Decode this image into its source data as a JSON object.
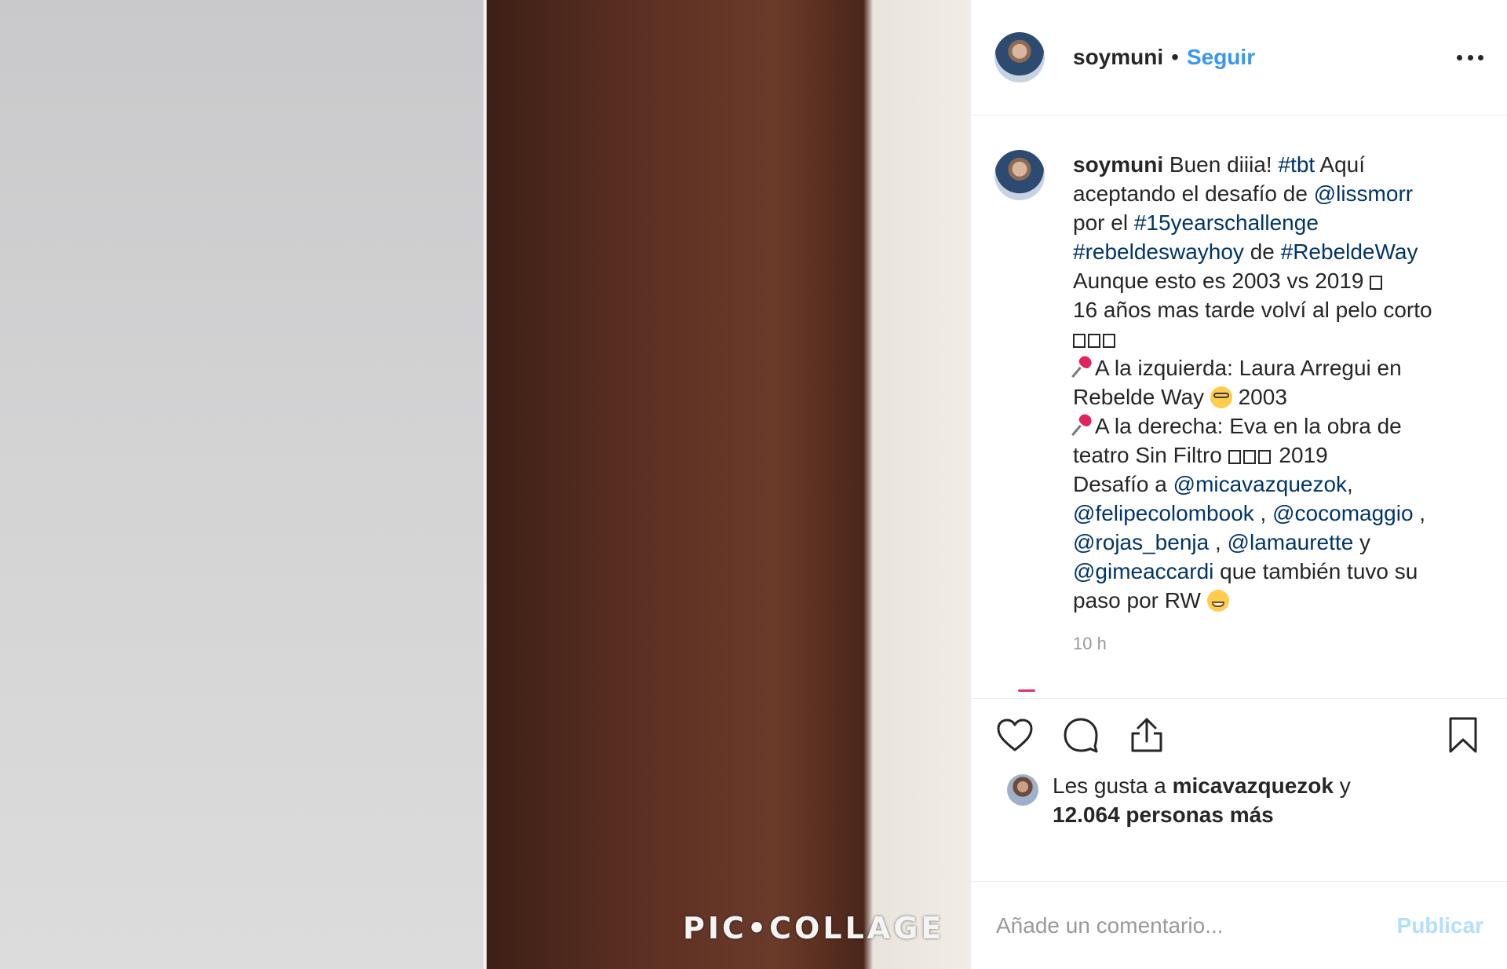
{
  "colors": {
    "accent": "#3897f0",
    "link": "#003569",
    "text": "#262626",
    "muted": "#999999",
    "publish_disabled": "#b2dffc",
    "border": "#efefef"
  },
  "media": {
    "watermark": "PIC•COLLAGE"
  },
  "header": {
    "username": "soymuni",
    "separator": "•",
    "follow_label": "Seguir",
    "more_icon": "more-horizontal-icon"
  },
  "caption": {
    "username": "soymuni",
    "l1": {
      "t1": "Buen diiia! ",
      "tag1": "#tbt",
      "t2": " Aquí"
    },
    "l2": {
      "t1": "aceptando el desafío de ",
      "mention": "@lissmorr"
    },
    "l3": {
      "t1": "por el ",
      "tag": "#15yearschallenge"
    },
    "l4": {
      "tag1": "#rebeldeswayhoy",
      "t1": " de ",
      "tag2": "#RebeldeWay"
    },
    "l5": {
      "t1": "Aunque esto es 2003 vs 2019 "
    },
    "l6": {
      "t1": "16 años mas tarde volví al pelo corto"
    },
    "l8": {
      "t1": "A la izquierda: Laura Arregui en"
    },
    "l9": {
      "t1": "Rebelde Way ",
      "t2": " 2003"
    },
    "l10": {
      "t1": "A la derecha: Eva en la obra de"
    },
    "l11": {
      "t1": "teatro Sin Filtro ",
      "t2": " 2019"
    },
    "l12": {
      "t1": "Desafío a ",
      "mention": "@micavazquezok",
      "t2": ","
    },
    "l13": {
      "mention1": "@felipecolombook",
      "t1": " , ",
      "mention2": "@cocomaggio",
      "t2": " ,"
    },
    "l14": {
      "mention1": "@rojas_benja",
      "t1": " , ",
      "mention2": "@lamaurette",
      "t2": " y"
    },
    "l15": {
      "mention": "@gimeaccardi",
      "t1": " que también tuvo su"
    },
    "l16": {
      "t1": "paso por RW "
    },
    "timestamp": "10 h"
  },
  "actions": {
    "like_icon": "heart-icon",
    "comment_icon": "comment-icon",
    "share_icon": "share-icon",
    "save_icon": "bookmark-icon"
  },
  "likes": {
    "prefix": "Les gusta a ",
    "user": "micavazquezok",
    "middle": " y",
    "count": "12.064 personas más"
  },
  "comment": {
    "placeholder": "Añade un comentario...",
    "value": "",
    "publish_label": "Publicar"
  }
}
